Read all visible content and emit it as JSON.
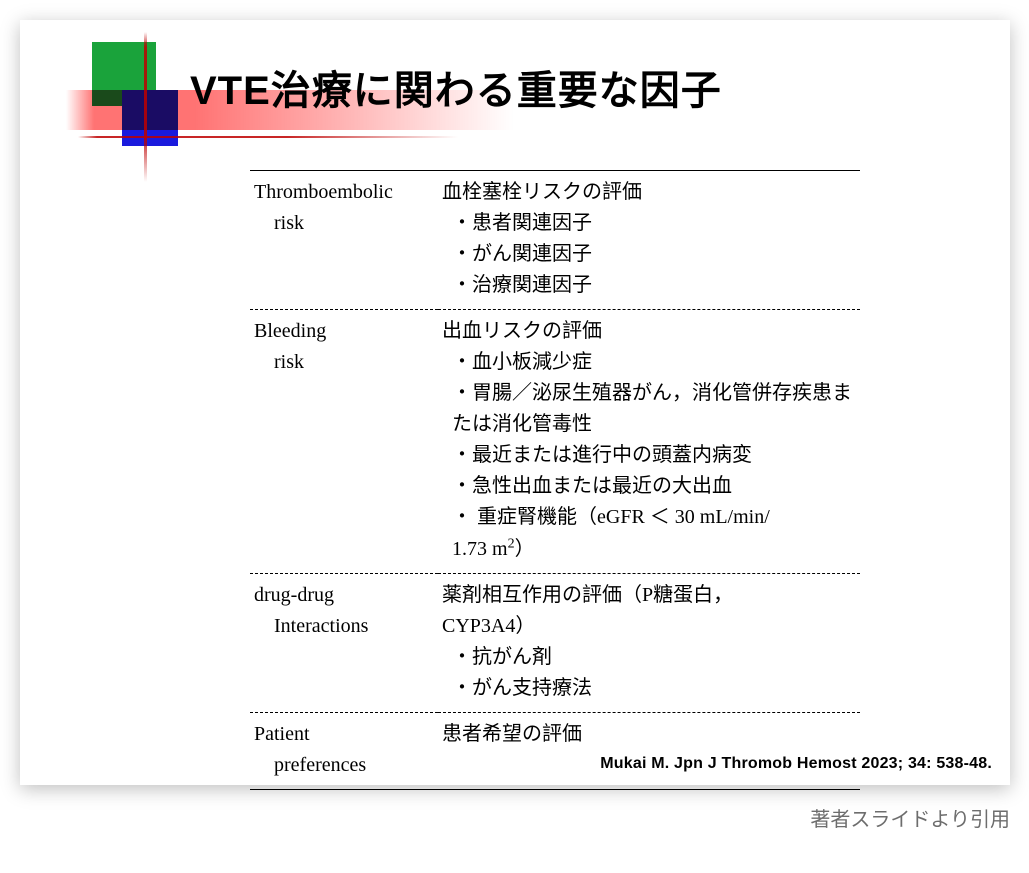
{
  "title": "VTE治療に関わる重要な因子",
  "rows": [
    {
      "label_l1": "Thromboembolic",
      "label_l2": "risk",
      "heading": "血栓塞栓リスクの評価",
      "items": [
        "患者関連因子",
        "がん関連因子",
        "治療関連因子"
      ]
    },
    {
      "label_l1": "Bleeding",
      "label_l2": "risk",
      "heading": "出血リスクの評価",
      "items": [
        "血小板減少症",
        "胃腸／泌尿生殖器がん，消化管併存疾患または消化管毒性",
        "最近または進行中の頭蓋内病変",
        "急性出血または最近の大出血",
        "重症腎機能（eGFR ＜ 30 mL/min/1.73 m²）"
      ]
    },
    {
      "label_l1": "drug-drug",
      "label_l2": "Interactions",
      "heading": "薬剤相互作用の評価（P糖蛋白，CYP3A4）",
      "items": [
        "抗がん剤",
        "がん支持療法"
      ]
    },
    {
      "label_l1": "Patient",
      "label_l2": "preferences",
      "heading": "患者希望の評価",
      "items": []
    }
  ],
  "citation": "Mukai M. Jpn J Thromob Hemost 2023; 34: 538-48.",
  "caption": "著者スライドより引用"
}
